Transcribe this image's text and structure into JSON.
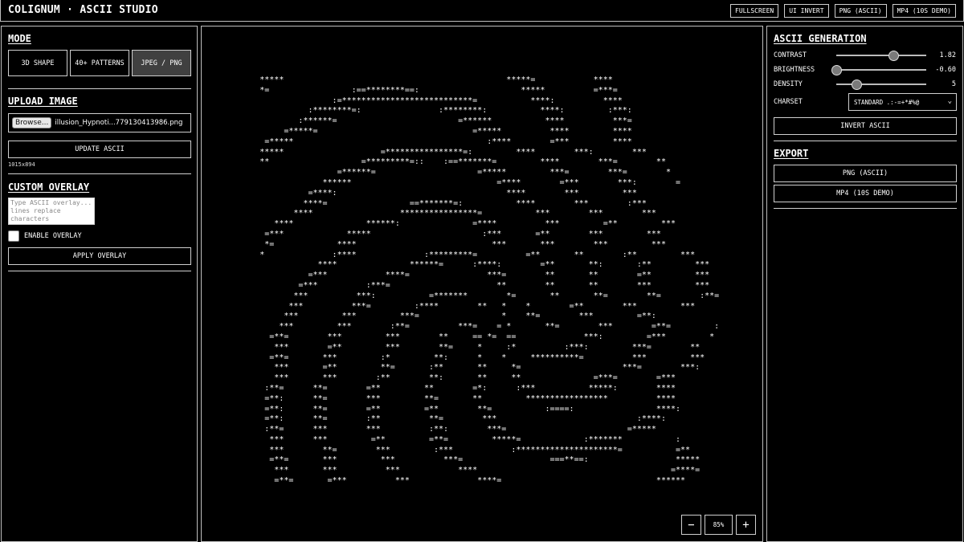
{
  "app": {
    "title": "COLIGNUM · ASCII STUDIO"
  },
  "toolbar": {
    "fullscreen": "FULLSCREEN",
    "ui_invert": "UI INVERT",
    "png_ascii": "PNG (ASCII)",
    "mp4_demo": "MP4 (10S DEMO)"
  },
  "mode": {
    "title": "MODE",
    "shape_3d": "3D SHAPE",
    "patterns": "40+ PATTERNS",
    "jpeg_png": "JPEG / PNG",
    "active": "JPEG / PNG"
  },
  "upload": {
    "title": "UPLOAD IMAGE",
    "browse": "Browse...",
    "file_name": "illusion_Hypnoti...779130413986.png",
    "update_button": "UPDATE ASCII",
    "dimensions": "1015x894"
  },
  "overlay": {
    "title": "CUSTOM OVERLAY",
    "placeholder": "Type ASCII overlay... lines replace characters",
    "enable_label": "ENABLE OVERLAY",
    "enabled": false,
    "apply_button": "APPLY OVERLAY"
  },
  "canvas": {
    "zoom_out": "−",
    "zoom_in": "+",
    "zoom_level": "85%",
    "ascii_lines": [
      "            *****                                              *****=            ****",
      "            *=                 :==********==:                     *****          =***=",
      "                           :=***************************=           ****:          ****",
      "                      :********=:                :********:           ****:         :***:",
      "                    :******=                         =******           ****          ***=",
      "                 =*****=                                =*****          ****         ****",
      "             =*****                                        :****        =***         ****",
      "            *****                    =****************=:         ****        ***:        ***",
      "            **                   =*********=::    :==*******=         ****        ***=        **",
      "                            =******=                     =*****         ***=        ***=        *",
      "                         ******                              =****        =***        ***:        =",
      "                      =****:                                   ****        ***         ***",
      "                     ****=                 ==*******=:           ****        ***        :***",
      "                   ****                  ****************=           ***        ***        ***",
      "               ****               ******:               =****          ***         =**         ***",
      "             =***             *****                       :***       =**        ***         ***",
      "             *=             ****                            ***       ***        ***         ***",
      "            *              :****              :*********=          =**       **        :**         ***",
      "                        ****               ******=      :****:        =**       **:       :**         ***",
      "                      =***            ****=                ***=        **       **        =**         ***",
      "                    =***          :***=                      **        **       **        ***         ***",
      "                   ***          ***:           =*******        *=       **       **=        **=        :**=",
      "                  ***          ***=         :****        **   *    *        =**        ***         ***",
      "                 ***         ***         ***=                 *    **=        ***         =**:",
      "                ***         ***        :**=          ***=    = *       **=        ***        =**=         :",
      "              =**=        ***         ***        **     == *=  ==              ***:         =***         *",
      "               ***        =**         ***        **=     *     :*          :***:         ***=        **",
      "              =**=       ***         :*         **:      *    *     **********=          ***         ***",
      "               ***       =**         **=       :**       **     *=                     ***=        ***:",
      "               ***       ***        :**        **:       **     **               =***=        =***",
      "             :**=      **=        =**         **        =*:      :***           *****:        ****",
      "             =**:      **=        ***         **=       **         *****************          ****",
      "             =**:      **=        =**         =**        **=           :====:                 ****:",
      "             =**:      **=        :**          **=        ***                             :****:",
      "             :**=      ***        ***          :**:        ***=                         =*****",
      "              ***      ***         =**         =**=         *****=             :*******           :",
      "              ***        **=        ***         :***            :*********************=           =**",
      "              =**=       ***         ***          ***=                  ===**==:                  *****",
      "               ***       ***          ***            ****                                        =****=",
      "               =**=       =***          ***              ****=                                ******"
    ]
  },
  "ascii_generation": {
    "title": "ASCII GENERATION",
    "contrast_label": "CONTRAST",
    "contrast_value": "1.82",
    "contrast_fraction": 0.63,
    "brightness_label": "BRIGHTNESS",
    "brightness_value": "-0.60",
    "brightness_fraction": 0.0,
    "density_label": "DENSITY",
    "density_value": "5",
    "density_fraction": 0.22,
    "charset_label": "CHARSET",
    "charset_value": "STANDARD .:-=+*#%@",
    "invert_button": "INVERT ASCII"
  },
  "export": {
    "title": "EXPORT",
    "png_button": "PNG (ASCII)",
    "mp4_button": "MP4 (10S DEMO)"
  },
  "icons": {
    "chevron": "chevron-down-icon"
  }
}
